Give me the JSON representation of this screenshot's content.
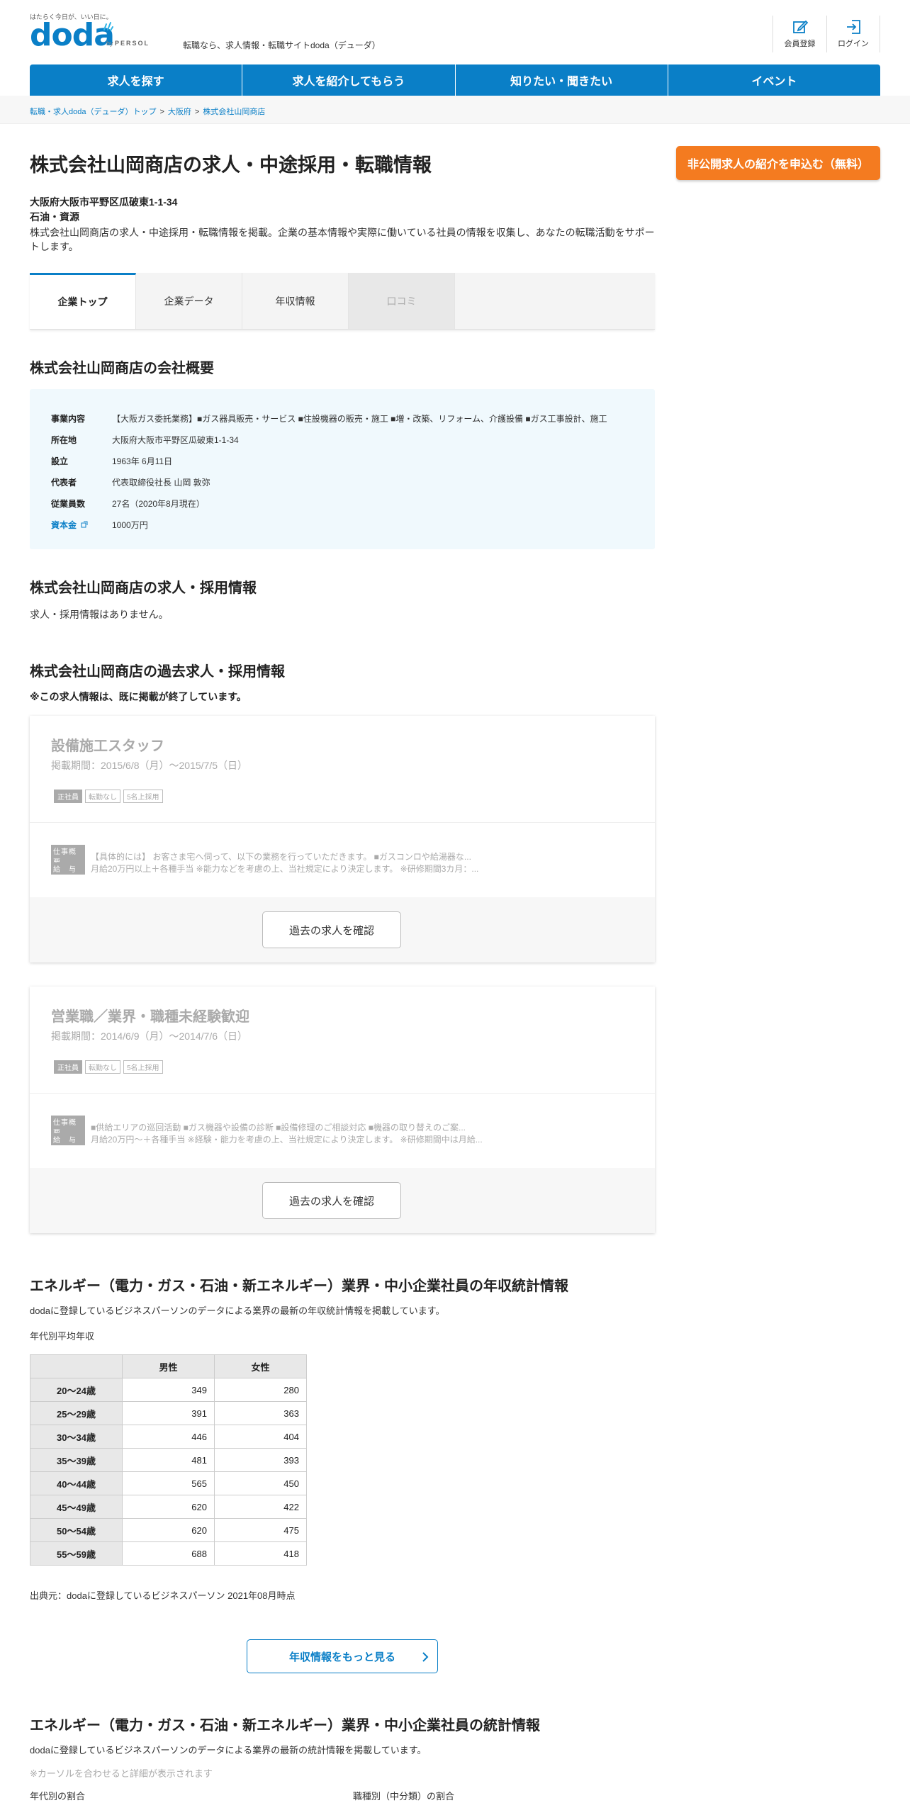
{
  "header": {
    "tagline": "はたらく今日が、いい日に。",
    "logo": "doda",
    "by": "by",
    "brand": "PERSOL",
    "site_desc": "転職なら、求人情報・転職サイトdoda（デューダ）",
    "register_label": "会員登録",
    "login_label": "ログイン"
  },
  "nav": [
    "求人を探す",
    "求人を紹介してもらう",
    "知りたい・聞きたい",
    "イベント"
  ],
  "breadcrumb": [
    "転職・求人doda（デューダ）トップ",
    "大阪府",
    "株式会社山岡商店"
  ],
  "company": {
    "title": "株式会社山岡商店の求人・中途採用・転職情報",
    "address": "大阪府大阪市平野区瓜破東1-1-34",
    "industry": "石油・資源",
    "intro": "株式会社山岡商店の求人・中途採用・転職情報を掲載。企業の基本情報や実際に働いている社員の情報を収集し、あなたの転職活動をサポートします。",
    "apply_button": "非公開求人の紹介を申込む（無料）"
  },
  "tabs": [
    "企業トップ",
    "企業データ",
    "年収情報",
    "口コミ"
  ],
  "overview": {
    "heading": "株式会社山岡商店の会社概要",
    "rows": [
      {
        "k": "事業内容",
        "v": "【大阪ガス委託業務】■ガス器具販売・サービス ■住設機器の販売・施工 ■増・改築、リフォーム、介護設備 ■ガス工事設計、施工"
      },
      {
        "k": "所在地",
        "v": "大阪府大阪市平野区瓜破東1-1-34"
      },
      {
        "k": "設立",
        "v": "1963年 6月11日"
      },
      {
        "k": "代表者",
        "v": "代表取締役社長 山岡 敦弥"
      },
      {
        "k": "従業員数",
        "v": "27名（2020年8月現在）"
      },
      {
        "k": "資本金",
        "v": "1000万円"
      }
    ]
  },
  "jobs_section": {
    "heading": "株式会社山岡商店の求人・採用情報",
    "empty": "求人・採用情報はありません。"
  },
  "past_section": {
    "heading": "株式会社山岡商店の過去求人・採用情報",
    "notice": "※この求人情報は、既に掲載が終了しています。",
    "jobs": [
      {
        "title": "設備施工スタッフ",
        "period": "掲載期間：2015/6/8（月）～2015/7/5（日）",
        "tags": [
          "正社員",
          "転勤なし",
          "5名上採用"
        ],
        "summary_label": "仕事概要",
        "summary": "【具体的には】 お客さま宅へ伺って、以下の業務を行っていただきます。 ■ガスコンロや給湯器な...",
        "salary_label": "給　与",
        "salary": "月給20万円以上＋各種手当 ※能力などを考慮の上、当社規定により決定します。 ※研修期間3カ月：...",
        "button": "過去の求人を確認"
      },
      {
        "title": "営業職／業界・職種未経験歓迎",
        "period": "掲載期間：2014/6/9（月）～2014/7/6（日）",
        "tags": [
          "正社員",
          "転勤なし",
          "5名上採用"
        ],
        "summary_label": "仕事概要",
        "summary": "■供給エリアの巡回活動 ■ガス機器や設備の診断 ■設備修理のご相談対応 ■機器の取り替えのご案...",
        "salary_label": "給　与",
        "salary": "月給20万円～＋各種手当 ※経験・能力を考慮の上、当社規定により決定します。 ※研修期間中は月給...",
        "button": "過去の求人を確認"
      }
    ]
  },
  "salary": {
    "heading": "エネルギー（電力・ガス・石油・新エネルギー）業界・中小企業社員の年収統計情報",
    "desc": "dodaに登録しているビジネスパーソンのデータによる業界の最新の年収統計情報を掲載しています。",
    "caption": "年代別平均年収",
    "columns": [
      "男性",
      "女性"
    ],
    "rows": [
      {
        "age": "20～24歳",
        "m": "349",
        "f": "280"
      },
      {
        "age": "25～29歳",
        "m": "391",
        "f": "363"
      },
      {
        "age": "30～34歳",
        "m": "446",
        "f": "404"
      },
      {
        "age": "35～39歳",
        "m": "481",
        "f": "393"
      },
      {
        "age": "40～44歳",
        "m": "565",
        "f": "450"
      },
      {
        "age": "45～49歳",
        "m": "620",
        "f": "422"
      },
      {
        "age": "50～54歳",
        "m": "620",
        "f": "475"
      },
      {
        "age": "55～59歳",
        "m": "688",
        "f": "418"
      }
    ],
    "source": "出典元：dodaに登録しているビジネスパーソン 2021年08月時点",
    "more_button": "年収情報をもっと見る"
  },
  "stats": {
    "heading": "エネルギー（電力・ガス・石油・新エネルギー）業界・中小企業社員の統計情報",
    "desc": "dodaに登録しているビジネスパーソンのデータによる業界の最新の統計情報を掲載しています。",
    "hint": "※カーソルを合わせると詳細が表示されます",
    "left_caption": "年代別の割合",
    "right_caption": "職種別（中分類）の割合"
  },
  "colors": {
    "brand": "#0a7fc7",
    "accent": "#f47b20"
  }
}
